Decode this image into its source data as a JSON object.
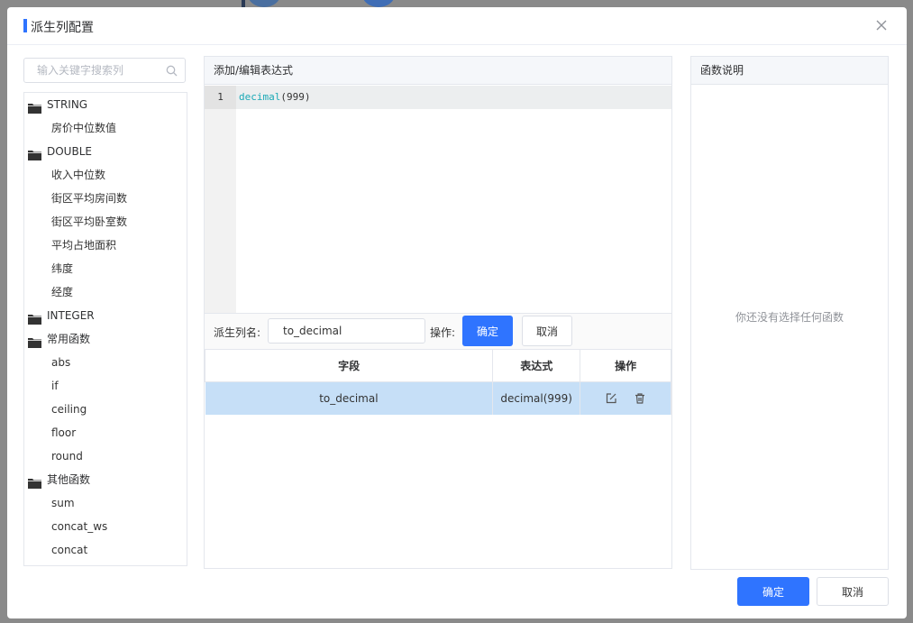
{
  "dialog": {
    "title": "派生列配置"
  },
  "search": {
    "placeholder": "输入关键字搜索列",
    "value": ""
  },
  "tree": {
    "groups": [
      {
        "label": "STRING",
        "items": [
          "房价中位数值"
        ]
      },
      {
        "label": "DOUBLE",
        "items": [
          "收入中位数",
          "街区平均房间数",
          "街区平均卧室数",
          "平均占地面积",
          "纬度",
          "经度"
        ]
      },
      {
        "label": "INTEGER",
        "items": []
      },
      {
        "label": "常用函数",
        "items": [
          "abs",
          "if",
          "ceiling",
          "floor",
          "round"
        ]
      },
      {
        "label": "其他函数",
        "items": [
          "sum",
          "concat_ws",
          "concat"
        ]
      }
    ]
  },
  "editor": {
    "header": "添加/编辑表达式",
    "line_number": "1",
    "code_keyword": "decimal",
    "code_rest": "(999)"
  },
  "form": {
    "name_label": "派生列名:",
    "name_value": "to_decimal",
    "op_label": "操作:",
    "confirm": "确定",
    "cancel": "取消"
  },
  "table": {
    "headers": [
      "字段",
      "表达式",
      "操作"
    ],
    "rows": [
      {
        "field": "to_decimal",
        "expression": "decimal(999)"
      }
    ]
  },
  "func_panel": {
    "header": "函数说明",
    "empty": "你还没有选择任何函数"
  },
  "footer": {
    "ok": "确定",
    "cancel": "取消"
  },
  "colors": {
    "primary": "#2f74ff",
    "selected_row": "#c6dff7"
  },
  "icons": {
    "close": "close-icon",
    "search": "search-icon",
    "folder": "folder-icon",
    "edit": "edit-icon",
    "delete": "trash-icon"
  }
}
